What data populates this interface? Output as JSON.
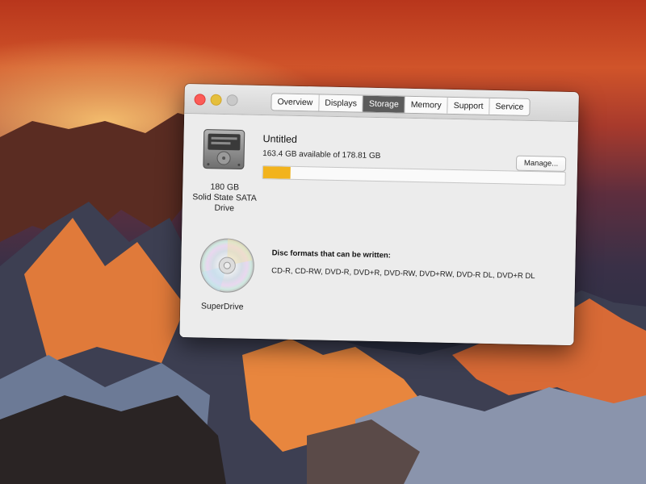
{
  "tabs": [
    {
      "label": "Overview",
      "active": false
    },
    {
      "label": "Displays",
      "active": false
    },
    {
      "label": "Storage",
      "active": true
    },
    {
      "label": "Memory",
      "active": false
    },
    {
      "label": "Support",
      "active": false
    },
    {
      "label": "Service",
      "active": false
    }
  ],
  "storage": {
    "drive_line1": "180 GB",
    "drive_line2": "Solid State SATA",
    "drive_line3": "Drive",
    "volume_name": "Untitled",
    "availability": "163.4 GB available of 178.81 GB",
    "used_fraction": 0.09,
    "bar_color": "#f2b31d",
    "manage_label": "Manage..."
  },
  "superdrive": {
    "label": "SuperDrive",
    "formats_heading": "Disc formats that can be written:",
    "formats": "CD-R, CD-RW, DVD-R, DVD+R, DVD-RW, DVD+RW, DVD-R DL, DVD+R DL"
  },
  "icons": {
    "close": "close-icon",
    "minimize": "minimize-icon",
    "zoom": "zoom-icon",
    "drive": "hard-drive-icon",
    "disc": "optical-disc-icon"
  }
}
